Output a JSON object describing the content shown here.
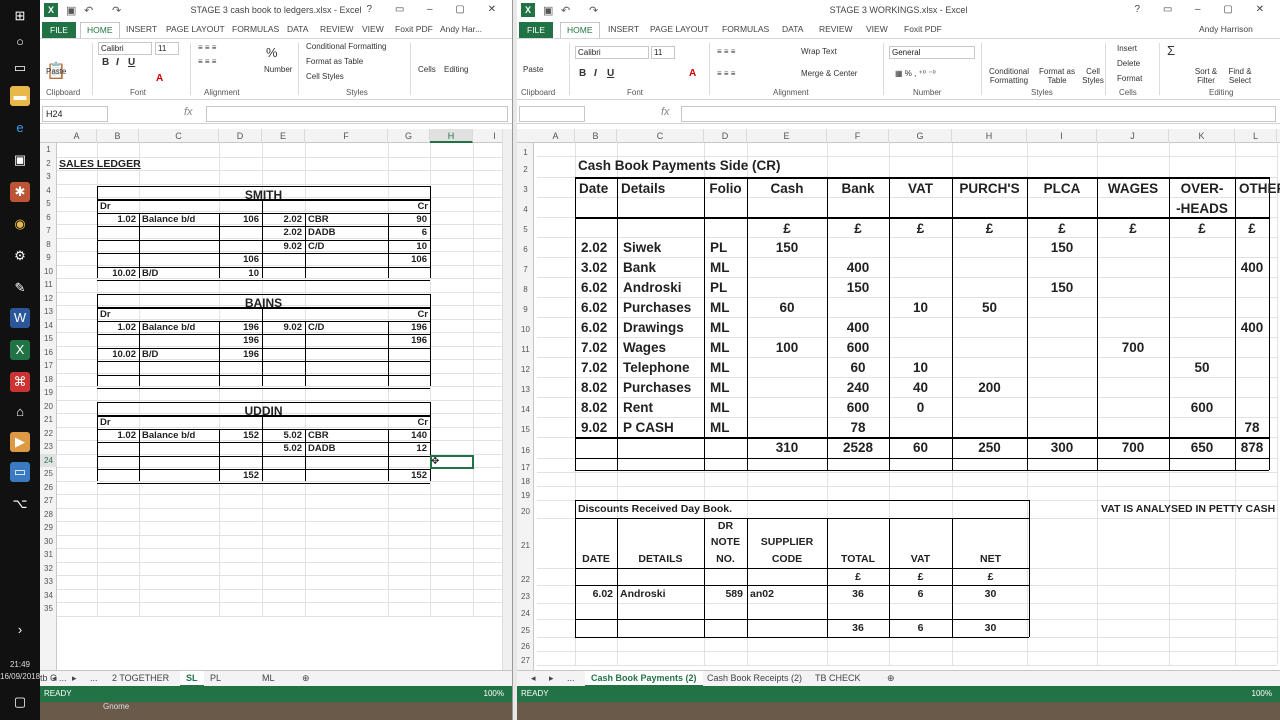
{
  "taskbar": {
    "time": "21:49",
    "date": "16/09/2018"
  },
  "left": {
    "title": "STAGE 3 cash book to ledgers.xlsx - Excel",
    "tabs": [
      "FILE",
      "HOME",
      "INSERT",
      "PAGE LAYOUT",
      "FORMULAS",
      "DATA",
      "REVIEW",
      "VIEW",
      "Foxit PDF"
    ],
    "user": "Andy Har...",
    "ribbon": {
      "clipboard": "Clipboard",
      "paste": "Paste",
      "font": "Font",
      "font_name": "Calibri",
      "font_size": "11",
      "alignment": "Alignment",
      "number": "Number",
      "cond_fmt": "Conditional Formatting",
      "fmt_table": "Format as Table",
      "cell_styles": "Cell Styles",
      "styles": "Styles",
      "cells": "Cells",
      "editing": "Editing"
    },
    "namebox": "H24",
    "fx": "fx",
    "col_headers": [
      "A",
      "B",
      "C",
      "D",
      "E",
      "F",
      "G",
      "H",
      "I"
    ],
    "rows": [
      "1",
      "2",
      "3",
      "4",
      "5",
      "6",
      "7",
      "8",
      "9",
      "10",
      "11",
      "12",
      "13",
      "14",
      "15",
      "16",
      "17",
      "18",
      "19",
      "20",
      "21",
      "22",
      "23",
      "24",
      "25",
      "26",
      "27",
      "28",
      "29",
      "30",
      "31",
      "32",
      "33",
      "34",
      "35"
    ],
    "sales_ledger": "SALES LEDGER",
    "accounts": [
      {
        "name": "SMITH",
        "dr": "Dr",
        "cr": "Cr",
        "lines": [
          [
            "1.02",
            "Balance b/d",
            "106",
            "2.02",
            "CBR",
            "90"
          ],
          [
            "",
            "",
            "",
            "2.02",
            "DADB",
            "6"
          ],
          [
            "",
            "",
            "",
            "9.02",
            "C/D",
            "10"
          ],
          [
            "",
            "",
            "106",
            "",
            "",
            "106"
          ],
          [
            "10.02",
            "B/D",
            "10",
            "",
            "",
            ""
          ]
        ]
      },
      {
        "name": "BAINS",
        "dr": "Dr",
        "cr": "Cr",
        "lines": [
          [
            "1.02",
            "Balance b/d",
            "196",
            "9.02",
            "C/D",
            "196"
          ],
          [
            "",
            "",
            "196",
            "",
            "",
            "196"
          ],
          [
            "10.02",
            "B/D",
            "196",
            "",
            "",
            ""
          ],
          [
            "",
            "",
            "",
            "",
            "",
            ""
          ],
          [
            "",
            "",
            "",
            "",
            "",
            ""
          ]
        ]
      },
      {
        "name": "UDDIN",
        "dr": "Dr",
        "cr": "Cr",
        "lines": [
          [
            "1.02",
            "Balance b/d",
            "152",
            "5.02",
            "CBR",
            "140"
          ],
          [
            "",
            "",
            "",
            "5.02",
            "DADB",
            "12"
          ],
          [
            "",
            "",
            "",
            "",
            "",
            ""
          ],
          [
            "",
            "",
            "152",
            "",
            "",
            "152"
          ]
        ]
      }
    ],
    "sheet_tabs": [
      "...",
      "2 TOGETHER",
      "SL",
      "PL",
      "ML",
      "tb C ..."
    ],
    "active_tab": "SL",
    "status": "READY",
    "zoom": "100%"
  },
  "right": {
    "title": "STAGE 3 WORKINGS.xlsx - Excel",
    "tabs": [
      "FILE",
      "HOME",
      "INSERT",
      "PAGE LAYOUT",
      "FORMULAS",
      "DATA",
      "REVIEW",
      "VIEW",
      "Foxit PDF"
    ],
    "user": "Andy Harrison",
    "ribbon": {
      "clipboard": "Clipboard",
      "paste": "Paste",
      "font": "Font",
      "font_name": "Calibri",
      "font_size": "11",
      "alignment": "Alignment",
      "wrap": "Wrap Text",
      "merge": "Merge & Center",
      "number": "Number",
      "number_fmt": "General",
      "cond_fmt": "Conditional Formatting",
      "fmt_table": "Format as Table",
      "cell_styles": "Cell Styles",
      "styles": "Styles",
      "insert": "Insert",
      "delete": "Delete",
      "format": "Format",
      "cells": "Cells",
      "sort": "Sort & Filter",
      "find": "Find & Select",
      "editing": "Editing"
    },
    "fx": "fx",
    "col_headers": [
      "A",
      "B",
      "C",
      "D",
      "E",
      "F",
      "G",
      "H",
      "I",
      "J",
      "K",
      "L"
    ],
    "rows": [
      "1",
      "2",
      "3",
      "4",
      "5",
      "6",
      "7",
      "8",
      "9",
      "10",
      "11",
      "12",
      "13",
      "14",
      "15",
      "16",
      "17",
      "18",
      "19",
      "20",
      "21",
      "22",
      "23",
      "24",
      "25",
      "26",
      "27"
    ],
    "cashbook_title": "Cash Book Payments Side (CR)",
    "headers": [
      "Date",
      "Details",
      "Folio",
      "Cash",
      "Bank",
      "VAT",
      "PURCH'S",
      "PLCA",
      "WAGES",
      "OVER-",
      "OTHER"
    ],
    "header_cont": "-HEADS",
    "pound": "£",
    "entries": [
      [
        "2.02",
        "Siwek",
        "PL",
        "150",
        "",
        "",
        "",
        "150",
        "",
        "",
        ""
      ],
      [
        "3.02",
        "Bank",
        "ML",
        "",
        "400",
        "",
        "",
        "",
        "",
        "",
        "400"
      ],
      [
        "6.02",
        "Androski",
        "PL",
        "",
        "150",
        "",
        "",
        "150",
        "",
        "",
        ""
      ],
      [
        "6.02",
        "Purchases",
        "ML",
        "60",
        "",
        "10",
        "50",
        "",
        "",
        "",
        ""
      ],
      [
        "6.02",
        "Drawings",
        "ML",
        "",
        "400",
        "",
        "",
        "",
        "",
        "",
        "400"
      ],
      [
        "7.02",
        "Wages",
        "ML",
        "100",
        "600",
        "",
        "",
        "",
        "700",
        "",
        ""
      ],
      [
        "7.02",
        "Telephone",
        "ML",
        "",
        "60",
        "10",
        "",
        "",
        "",
        "50",
        ""
      ],
      [
        "8.02",
        "Purchases",
        "ML",
        "",
        "240",
        "40",
        "200",
        "",
        "",
        "",
        ""
      ],
      [
        "8.02",
        "Rent",
        "ML",
        "",
        "600",
        "0",
        "",
        "",
        "",
        "600",
        ""
      ],
      [
        "9.02",
        "P CASH",
        "ML",
        "",
        "78",
        "",
        "",
        "",
        "",
        "",
        "78"
      ]
    ],
    "totals": [
      "",
      "",
      "",
      "310",
      "2528",
      "60",
      "250",
      "300",
      "700",
      "650",
      "878"
    ],
    "drb_title": "Discounts Received Day Book.",
    "vat_note": "VAT IS ANALYSED IN PETTY CASH",
    "drb_headers": [
      "DATE",
      "DETAILS",
      "DR",
      "NOTE",
      "NO.",
      "SUPPLIER",
      "CODE",
      "TOTAL",
      "VAT",
      "NET"
    ],
    "drb_row": [
      "6.02",
      "Androski",
      "589",
      "an02",
      "36",
      "6",
      "30"
    ],
    "drb_totals": [
      "36",
      "6",
      "30"
    ],
    "sheet_tabs": [
      "...",
      "Cash Book Payments (2)",
      "Cash Book Receipts (2)",
      "TB CHECK"
    ],
    "status": "READY",
    "zoom": "100%"
  },
  "footer_text": "Gnome"
}
